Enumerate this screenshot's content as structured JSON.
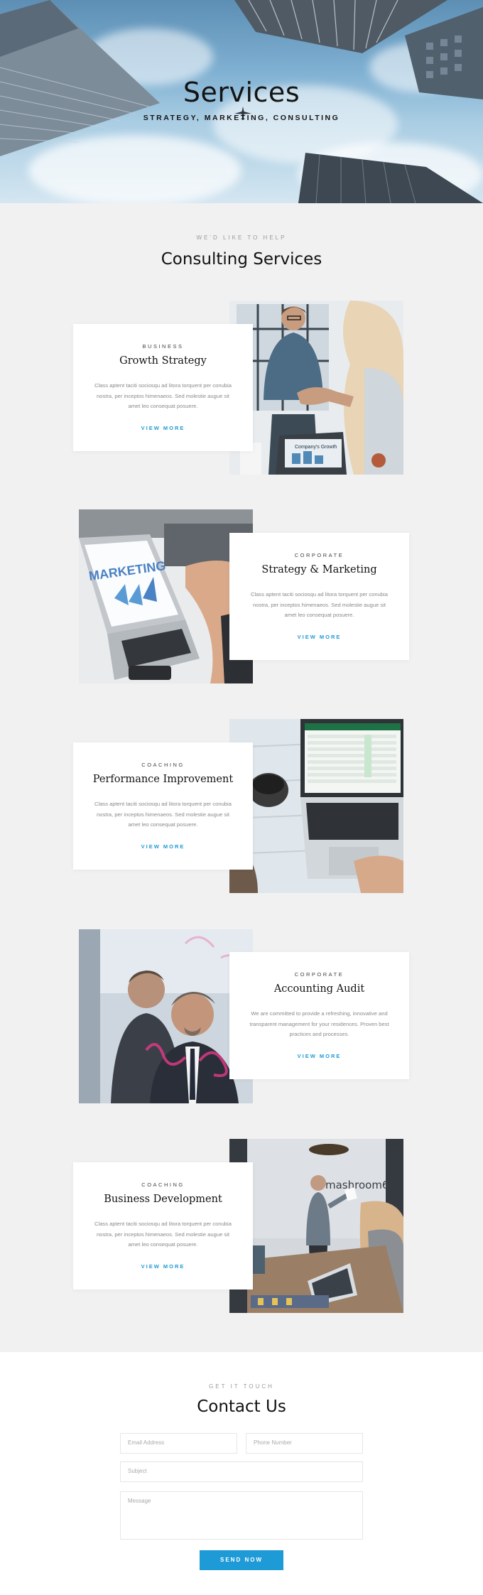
{
  "hero": {
    "title": "Services",
    "subtitle": "STRATEGY, MARKETING, CONSULTING"
  },
  "services_section": {
    "eyebrow": "WE'D LIKE TO HELP",
    "title": "Consulting Services"
  },
  "services": [
    {
      "category": "BUSINESS",
      "title": "Growth Strategy",
      "description": "Class aptent taciti sociosqu ad litora torquent per conubia nostra, per inceptos himenaeos. Sed molestie augue sit amet leo consequat posuere.",
      "link": "VIEW MORE",
      "image": "handshake-laptop-photo"
    },
    {
      "category": "CORPORATE",
      "title": "Strategy & Marketing",
      "description": "Class aptent taciti sociosqu ad litora torquent per conubia nostra, per inceptos himenaeos. Sed molestie augue sit amet leo consequat posuere.",
      "link": "VIEW MORE",
      "image": "marketing-laptop-photo",
      "image_text": "MARKETING"
    },
    {
      "category": "COACHING",
      "title": "Performance Improvement",
      "description": "Class aptent taciti sociosqu ad litora torquent per conubia nostra, per inceptos himenaeos. Sed molestie augue sit amet leo consequat posuere.",
      "link": "VIEW MORE",
      "image": "spreadsheet-laptop-photo"
    },
    {
      "category": "CORPORATE",
      "title": "Accounting Audit",
      "description": "We are committed to provide a refreshing, innovative and transparent management for your residences. Proven best practices and processes.",
      "link": "VIEW MORE",
      "image": "businessmen-glass-photo"
    },
    {
      "category": "COACHING",
      "title": "Business Development",
      "description": "Class aptent taciti sociosqu ad litora torquent per conubia nostra, per inceptos himenaeos. Sed molestie augue sit amet leo consequat posuere.",
      "link": "VIEW MORE",
      "image": "office-presentation-photo",
      "image_text": "mashroom6"
    }
  ],
  "contact": {
    "eyebrow": "GET IT TOUCH",
    "title": "Contact Us",
    "email_placeholder": "Email Address",
    "phone_placeholder": "Phone Number",
    "subject_placeholder": "Subject",
    "message_placeholder": "Message",
    "send_label": "SEND NOW"
  },
  "colors": {
    "accent": "#1e9ad6",
    "page_bg": "#f1f1f1",
    "card_bg": "#ffffff"
  }
}
